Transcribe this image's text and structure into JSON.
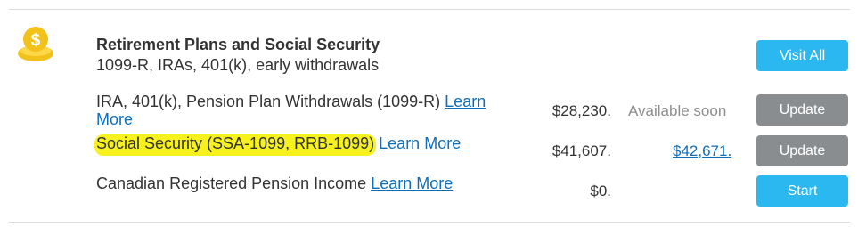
{
  "section": {
    "icon": "money-bag-icon",
    "title": "Retirement Plans and Social Security",
    "subtitle": "1099-R, IRAs, 401(k), early withdrawals",
    "visit_all_label": "Visit All"
  },
  "rows": [
    {
      "label": "IRA, 401(k), Pension Plan Withdrawals (1099-R)",
      "link": "Learn More",
      "amount": "$28,230.",
      "status": "Available soon",
      "button": "Update"
    },
    {
      "label": "Social Security (SSA-1099, RRB-1099)",
      "link": "Learn More",
      "amount": "$41,607.",
      "linked_amount": "$42,671.",
      "button": "Update"
    },
    {
      "label": "Canadian Registered Pension Income",
      "link": "Learn More",
      "amount": "$0.",
      "button": "Start"
    }
  ],
  "colors": {
    "accent_blue": "#2bb7ef",
    "button_gray": "#8a8d90",
    "link_blue": "#0f6eb8",
    "highlight_yellow": "#f7f21e",
    "icon_gold": "#f2c21b"
  }
}
